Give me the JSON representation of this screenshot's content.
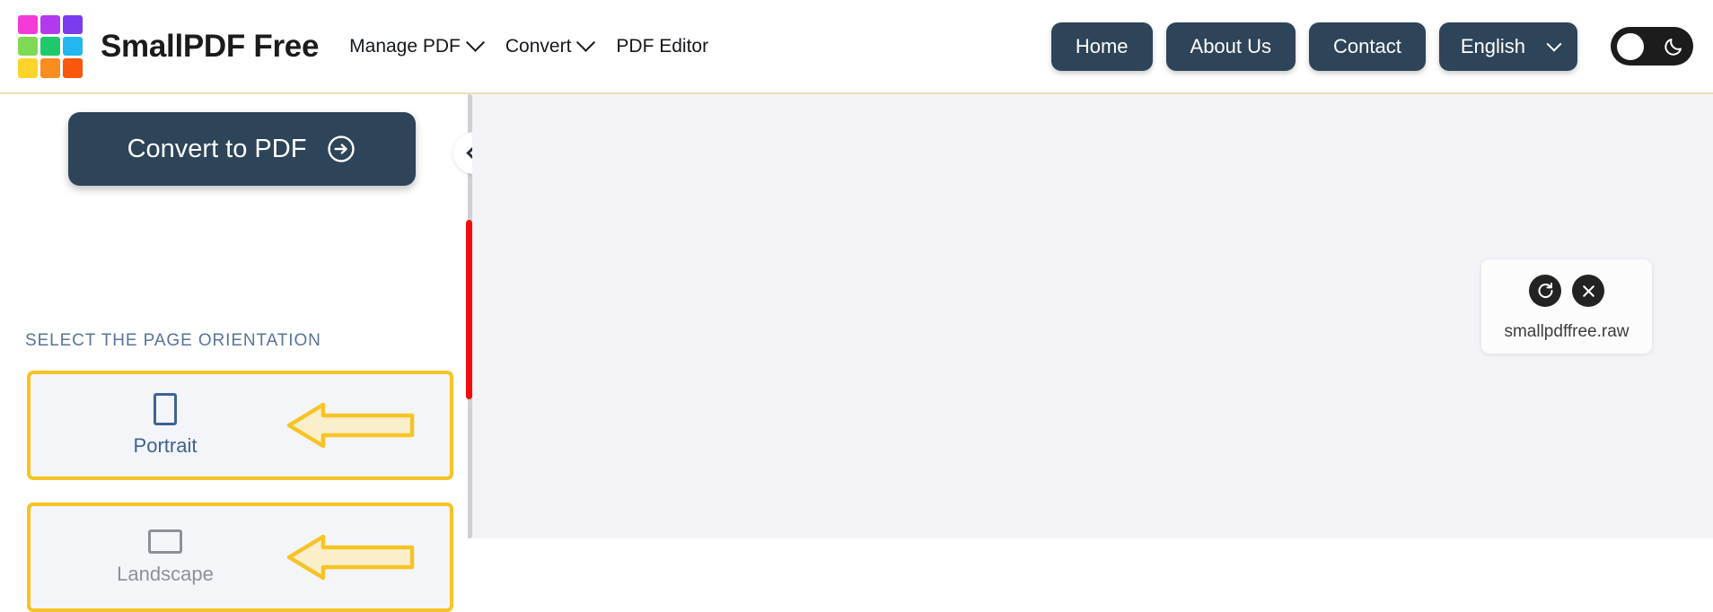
{
  "header": {
    "brand_title": "SmallPDF Free",
    "logo_colors": [
      "#f43bd8",
      "#b339f0",
      "#7b3bef",
      "#7ed957",
      "#1ec96b",
      "#23b7f0",
      "#ffd42a",
      "#fb8c1e",
      "#f9560e"
    ],
    "nav_items": [
      {
        "label": "Manage PDF",
        "has_caret": true
      },
      {
        "label": "Convert",
        "has_caret": true
      },
      {
        "label": "PDF Editor",
        "has_caret": false
      }
    ],
    "buttons": [
      {
        "label": "Home",
        "name": "home"
      },
      {
        "label": "About Us",
        "name": "about-us"
      },
      {
        "label": "Contact",
        "name": "contact"
      }
    ],
    "language": {
      "label": "English",
      "caret_icon": "chevron-down-icon"
    },
    "dark_mode_toggle": {
      "state": "off",
      "icon": "moon-icon"
    },
    "accent_border_color": "#e8e0b8",
    "button_color": "#2e4459"
  },
  "left_panel": {
    "convert_button": {
      "label": "Convert to PDF",
      "icon": "arrow-right-circle-icon"
    },
    "section_label": "SELECT THE PAGE ORIENTATION",
    "orientation_options": [
      {
        "label": "Portrait",
        "icon": "portrait-rect-icon",
        "selected": true,
        "highlighted": true
      },
      {
        "label": "Landscape",
        "icon": "landscape-rect-icon",
        "selected": false,
        "highlighted": true
      }
    ],
    "highlight_color": "#f7c325",
    "collapse_button_icon": "chevron-left-icon",
    "scrollbar": {
      "thumb_color": "#f40b0b",
      "track_color": "#cfcfd4"
    }
  },
  "workspace": {
    "background_color": "#f4f4f8",
    "file_card": {
      "file_name": "smallpdffree.raw",
      "actions": [
        {
          "name": "rotate",
          "icon": "rotate-cw-icon"
        },
        {
          "name": "remove",
          "icon": "close-x-icon"
        }
      ]
    },
    "add_document": {
      "icon": "document-add-icon",
      "count": "1"
    }
  }
}
